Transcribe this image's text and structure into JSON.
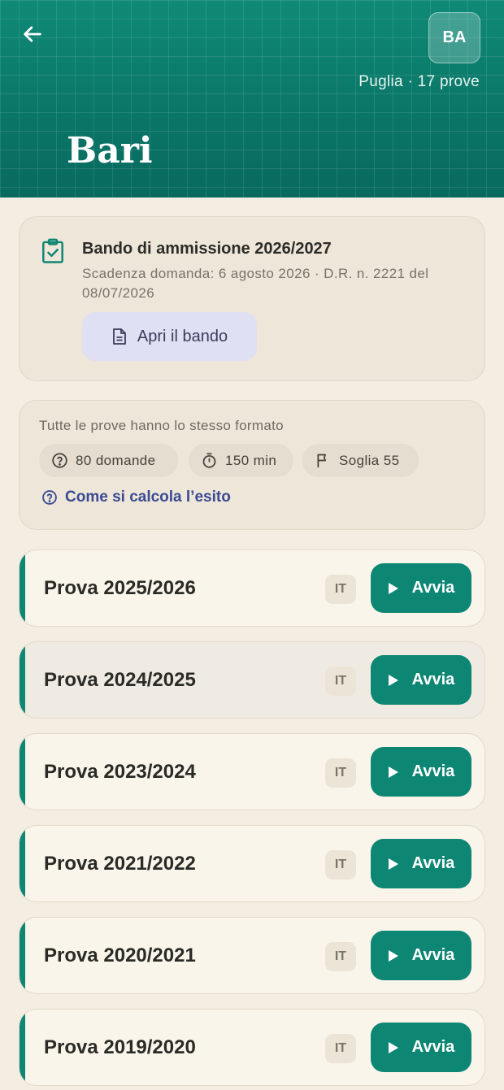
{
  "header": {
    "avatar_initials": "BA",
    "region_info": "Puglia · 17 prove",
    "city": "Bari",
    "accent_color": "#0b7a6c"
  },
  "bando": {
    "title": "Bando di ammissione 2026/2027",
    "deadline": "Scadenza domanda: 6 agosto 2026",
    "decree": "D.R. n. 2221 del 08/07/2026",
    "button_label": "Apri il bando"
  },
  "format": {
    "title": "Tutte le prove hanno lo stesso formato",
    "questions": "80 domande",
    "duration": "150 min",
    "threshold": "Soglia 55",
    "link_label": "Come si calcola l’esito"
  },
  "prove": [
    {
      "label": "Prova 2025/2026",
      "lang": "IT",
      "action": "Avvia"
    },
    {
      "label": "Prova 2024/2025",
      "lang": "IT",
      "action": "Avvia"
    },
    {
      "label": "Prova 2023/2024",
      "lang": "IT",
      "action": "Avvia"
    },
    {
      "label": "Prova 2021/2022",
      "lang": "IT",
      "action": "Avvia"
    },
    {
      "label": "Prova 2020/2021",
      "lang": "IT",
      "action": "Avvia"
    },
    {
      "label": "Prova 2019/2020",
      "lang": "IT",
      "action": "Avvia"
    }
  ]
}
